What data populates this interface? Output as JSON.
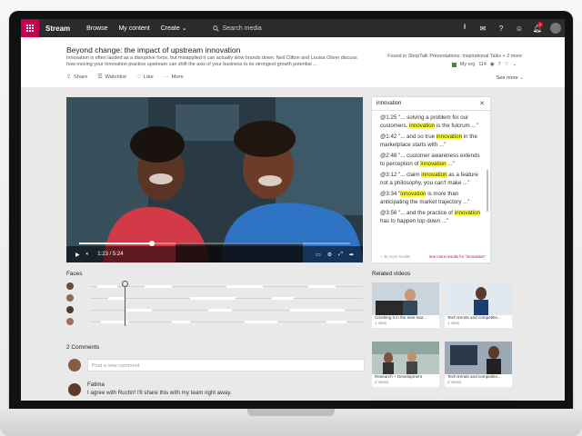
{
  "colors": {
    "brand": "#c30052",
    "highlight": "#ffff3a",
    "topbar": "#2b2b2b"
  },
  "nav": {
    "brand": "Stream",
    "browse": "Browse",
    "my_content": "My content",
    "create": "Create",
    "search_placeholder": "Search media",
    "notification_count": "1"
  },
  "video": {
    "title": "Beyond change: the impact of upstream innovation",
    "description": "Innovation is often lauded as a disruptive force, but misapplied it can actually slow brands down. Neil Clifton and Louisa Oliver discuss how moving your innovation practice upstream can shift the axis of your business to its strongest growth potential ...",
    "found_in": "Found in ShopTalk Presentations: Inspirational Talks + 2 more",
    "org": "My org",
    "views": "114",
    "likes": "7",
    "time_display": "1:23 / 5:24",
    "progress_fraction": 0.27
  },
  "actions": {
    "share": "Share",
    "watchlist": "Watchlist",
    "like": "Like",
    "more": "More",
    "see_more": "See more"
  },
  "transcript": {
    "query": "innovation",
    "lines": [
      {
        "time": "@1:25",
        "pre": " \"... solving a problem for our customers, ",
        "hl": "innovation",
        "post": " is the fulcrum ...\""
      },
      {
        "time": "@1:42",
        "pre": " \"... and so true ",
        "hl": "innovation",
        "post": " in the marketplace starts with ...\""
      },
      {
        "time": "@2:48",
        "pre": " \"... customer awareness extends to perception of ",
        "hl": "innovation",
        "post": " ...\""
      },
      {
        "time": "@3:12",
        "pre": " \"... claim ",
        "hl": "innovation",
        "post": " as a feature not a philosophy, you can't make ...\""
      },
      {
        "time": "@3:34",
        "pre": " \"",
        "hl": "innovation",
        "post": " is more than anticipating the market trajectory ...\""
      },
      {
        "time": "@3:56",
        "pre": " \"... and the practice of ",
        "hl": "innovation",
        "post": " has to happen top down ...\""
      }
    ],
    "more_results": "+ 36 more results",
    "see_more_results": "See more results for \"innovation\""
  },
  "faces": {
    "label": "Faces"
  },
  "related": {
    "label": "Related videos",
    "items": [
      {
        "title": "Crushing it in the new mar...",
        "views": "1 view"
      },
      {
        "title": "Tech trends and competitio...",
        "views": "1 view"
      },
      {
        "title": "Research + Development",
        "views": "2 views"
      },
      {
        "title": "Tech trends and competitio...",
        "views": "2 views"
      }
    ]
  },
  "comments": {
    "label": "2 Comments",
    "placeholder": "Post a new comment",
    "first": {
      "name": "Fatima",
      "text": "I agree with Ruchir! I'll share this with my team right away."
    }
  }
}
